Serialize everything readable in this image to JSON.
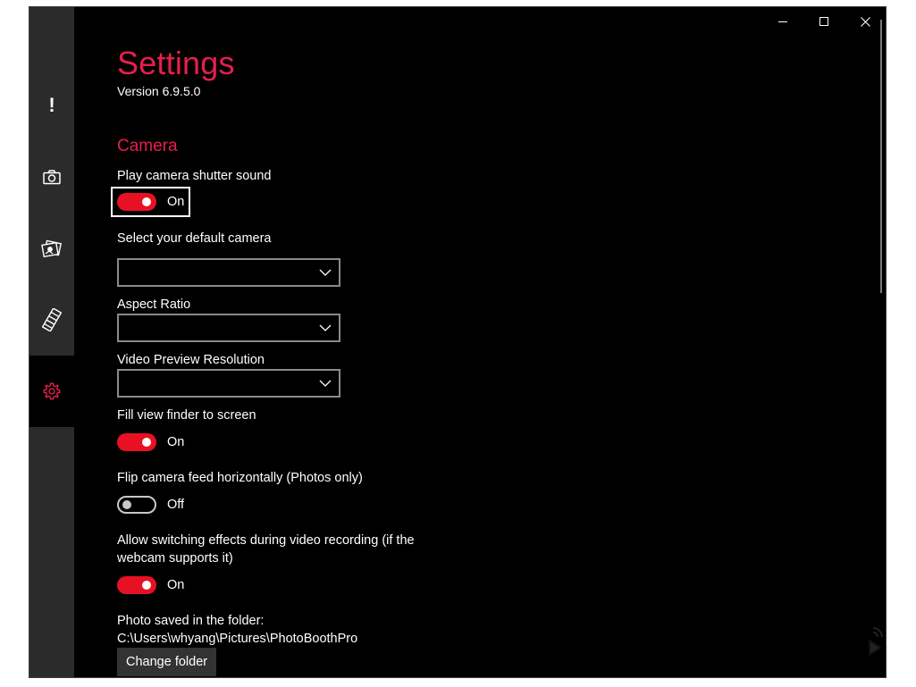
{
  "window": {
    "caption_buttons": [
      "minimize",
      "maximize",
      "close"
    ]
  },
  "nav": {
    "items": [
      {
        "id": "whats-new",
        "icon": "exclamation-icon",
        "glyph": "!"
      },
      {
        "id": "camera",
        "icon": "camera-icon"
      },
      {
        "id": "gallery",
        "icon": "photos-icon"
      },
      {
        "id": "effects",
        "icon": "filmstrip-icon"
      },
      {
        "id": "settings",
        "icon": "gear-icon",
        "active": true
      }
    ]
  },
  "page": {
    "title": "Settings",
    "version": "Version 6.9.5.0"
  },
  "camera_section": {
    "heading": "Camera",
    "shutter_sound": {
      "label": "Play camera shutter sound",
      "state": "On"
    },
    "default_camera": {
      "label": "Select your default camera",
      "value": ""
    },
    "aspect_ratio": {
      "label": "Aspect Ratio",
      "value": ""
    },
    "preview_resolution": {
      "label": "Video Preview Resolution",
      "value": ""
    },
    "fill_view": {
      "label": "Fill view finder to screen",
      "state": "On"
    },
    "flip_feed": {
      "label": "Flip camera feed horizontally (Photos only)",
      "state": "Off"
    },
    "switch_effects": {
      "label": "Allow switching effects during video recording (if the webcam supports it)",
      "state": "On"
    },
    "photo_folder": {
      "label": "Photo saved in the folder:",
      "path": "C:\\Users\\whyang\\Pictures\\PhotoBoothPro",
      "button": "Change folder"
    }
  },
  "colors": {
    "accent": "#e81e4c",
    "toggle_on": "#e81123",
    "background": "#000000",
    "nav_background": "#2b2b2b"
  }
}
